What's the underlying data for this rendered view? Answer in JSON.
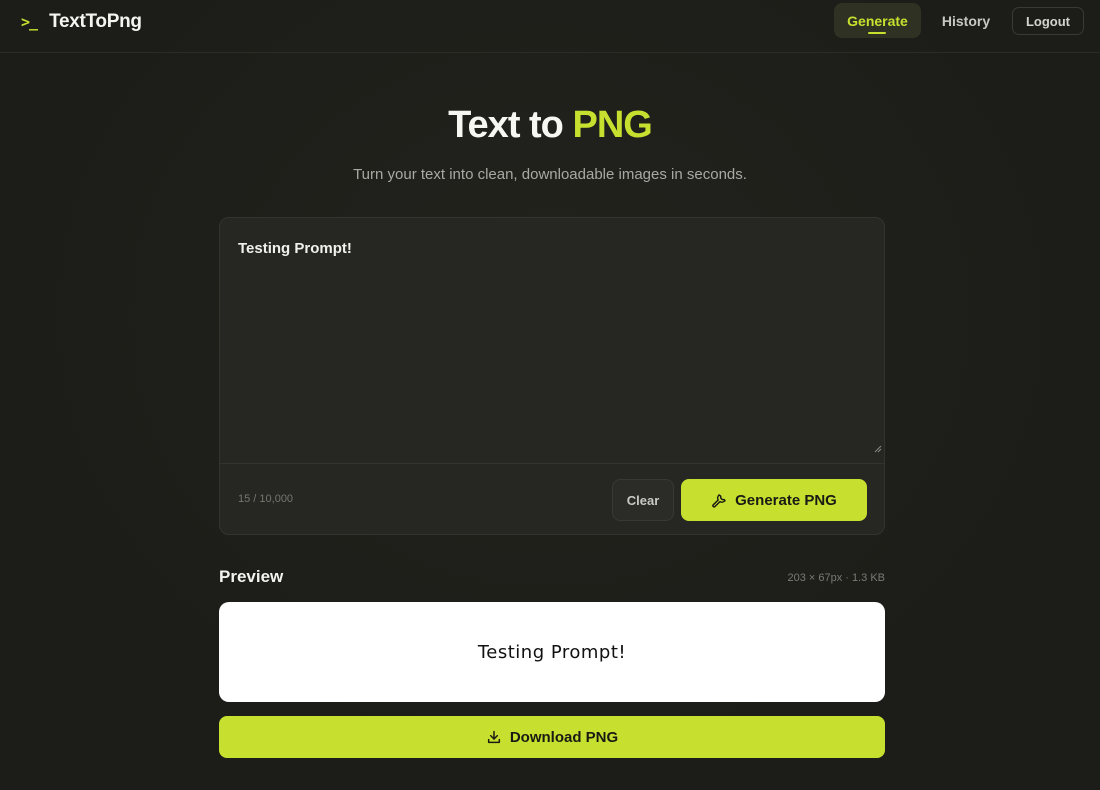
{
  "brand": {
    "icon": "terminal-prompt-icon",
    "symbol": ">_",
    "name": "TextToPng"
  },
  "nav": {
    "generate_label": "Generate",
    "history_label": "History",
    "logout_label": "Logout"
  },
  "hero": {
    "title_main": "Text to",
    "title_accent": "PNG",
    "subtitle": "Turn your text into clean, downloadable images in seconds."
  },
  "editor": {
    "value": "Testing Prompt!",
    "char_count": "15 / 10,000",
    "clear_label": "Clear",
    "generate_label": "Generate PNG",
    "generate_icon": "wrench-icon"
  },
  "preview": {
    "label": "Preview",
    "meta": "203 × 67px · 1.3 KB",
    "image_text": "Testing Prompt!"
  },
  "download": {
    "label": "Download PNG",
    "icon": "download-icon"
  },
  "colors": {
    "accent": "#c7e02f",
    "background": "#1d1d19",
    "card": "#262622"
  }
}
